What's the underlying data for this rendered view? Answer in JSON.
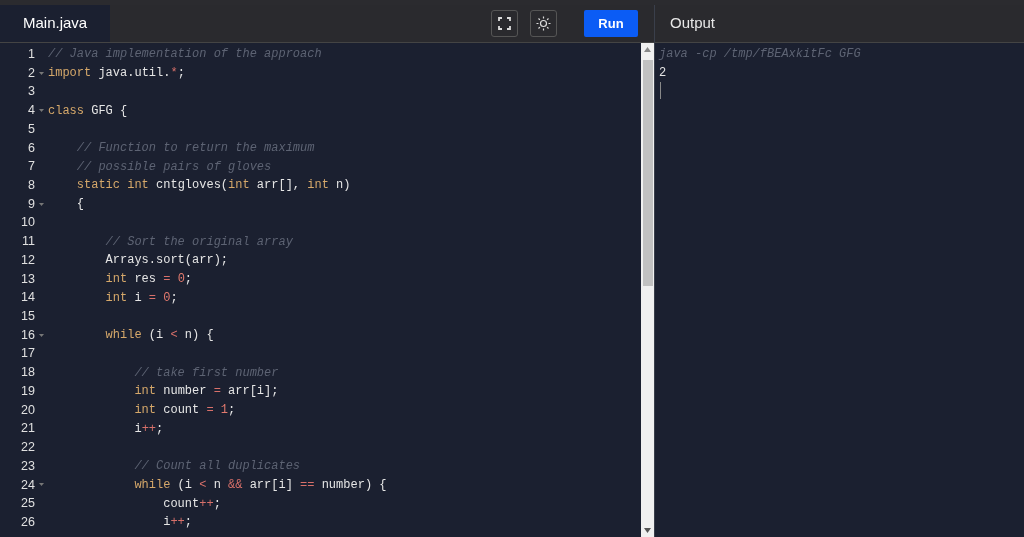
{
  "editor": {
    "tab": {
      "label": "Main.java",
      "selected": true
    },
    "toolbar": [
      {
        "kind": "fullscreen"
      },
      {
        "kind": "theme"
      },
      {
        "kind": "run",
        "label": "Run"
      }
    ],
    "lines": [
      {
        "number": "1",
        "foldable": false,
        "tokens": [
          {
            "kind": "comment",
            "text": "// Java implementation of the approach"
          }
        ]
      },
      {
        "number": "2",
        "foldable": true,
        "tokens": [
          {
            "kind": "keyword",
            "text": "import"
          },
          {
            "kind": "plain",
            "text": " java.util."
          },
          {
            "kind": "operator",
            "text": "*"
          },
          {
            "kind": "plain",
            "text": ";"
          }
        ]
      },
      {
        "number": "3",
        "foldable": false
      },
      {
        "number": "4",
        "foldable": true,
        "tokens": [
          {
            "kind": "keyword",
            "text": "class"
          },
          {
            "kind": "plain",
            "text": " GFG {"
          }
        ]
      },
      {
        "number": "5",
        "foldable": false
      },
      {
        "number": "6",
        "foldable": false,
        "tokens": [
          {
            "kind": "comment",
            "text": "    // Function to return the maximum"
          }
        ]
      },
      {
        "number": "7",
        "foldable": false,
        "tokens": [
          {
            "kind": "comment",
            "text": "    // possible pairs of gloves"
          }
        ]
      },
      {
        "number": "8",
        "foldable": false,
        "tokens": [
          {
            "kind": "keyword",
            "text": "    static int"
          },
          {
            "kind": "plain",
            "text": " cntgloves("
          },
          {
            "kind": "keyword",
            "text": "int"
          },
          {
            "kind": "plain",
            "text": " arr[], "
          },
          {
            "kind": "keyword",
            "text": "int"
          },
          {
            "kind": "plain",
            "text": " n)"
          }
        ]
      },
      {
        "number": "9",
        "foldable": true,
        "tokens": [
          {
            "kind": "plain",
            "text": "    {"
          }
        ]
      },
      {
        "number": "10",
        "foldable": false
      },
      {
        "number": "11",
        "foldable": false,
        "tokens": [
          {
            "kind": "comment",
            "text": "        // Sort the original array"
          }
        ]
      },
      {
        "number": "12",
        "foldable": false,
        "tokens": [
          {
            "kind": "plain",
            "text": "        Arrays.sort(arr);"
          }
        ]
      },
      {
        "number": "13",
        "foldable": false,
        "tokens": [
          {
            "kind": "keyword",
            "text": "        int"
          },
          {
            "kind": "plain",
            "text": " res "
          },
          {
            "kind": "operator",
            "text": "="
          },
          {
            "kind": "number",
            "text": " 0"
          },
          {
            "kind": "plain",
            "text": ";"
          }
        ]
      },
      {
        "number": "14",
        "foldable": false,
        "tokens": [
          {
            "kind": "keyword",
            "text": "        int"
          },
          {
            "kind": "plain",
            "text": " i "
          },
          {
            "kind": "operator",
            "text": "="
          },
          {
            "kind": "number",
            "text": " 0"
          },
          {
            "kind": "plain",
            "text": ";"
          }
        ]
      },
      {
        "number": "15",
        "foldable": false
      },
      {
        "number": "16",
        "foldable": true,
        "tokens": [
          {
            "kind": "keyword",
            "text": "        while"
          },
          {
            "kind": "plain",
            "text": " (i "
          },
          {
            "kind": "operator",
            "text": "<"
          },
          {
            "kind": "plain",
            "text": " n) {"
          }
        ]
      },
      {
        "number": "17",
        "foldable": false
      },
      {
        "number": "18",
        "foldable": false,
        "tokens": [
          {
            "kind": "comment",
            "text": "            // take first number"
          }
        ]
      },
      {
        "number": "19",
        "foldable": false,
        "tokens": [
          {
            "kind": "keyword",
            "text": "            int"
          },
          {
            "kind": "plain",
            "text": " number "
          },
          {
            "kind": "operator",
            "text": "="
          },
          {
            "kind": "plain",
            "text": " arr[i];"
          }
        ]
      },
      {
        "number": "20",
        "foldable": false,
        "tokens": [
          {
            "kind": "keyword",
            "text": "            int"
          },
          {
            "kind": "plain",
            "text": " count "
          },
          {
            "kind": "operator",
            "text": "="
          },
          {
            "kind": "number",
            "text": " 1"
          },
          {
            "kind": "plain",
            "text": ";"
          }
        ]
      },
      {
        "number": "21",
        "foldable": false,
        "tokens": [
          {
            "kind": "plain",
            "text": "            i"
          },
          {
            "kind": "operator",
            "text": "++"
          },
          {
            "kind": "plain",
            "text": ";"
          }
        ]
      },
      {
        "number": "22",
        "foldable": false
      },
      {
        "number": "23",
        "foldable": false,
        "tokens": [
          {
            "kind": "comment",
            "text": "            // Count all duplicates"
          }
        ]
      },
      {
        "number": "24",
        "foldable": true,
        "tokens": [
          {
            "kind": "keyword",
            "text": "            while"
          },
          {
            "kind": "plain",
            "text": " (i "
          },
          {
            "kind": "operator",
            "text": "<"
          },
          {
            "kind": "plain",
            "text": " n "
          },
          {
            "kind": "operator",
            "text": "&&"
          },
          {
            "kind": "plain",
            "text": " arr[i] "
          },
          {
            "kind": "operator",
            "text": "=="
          },
          {
            "kind": "plain",
            "text": " number) {"
          }
        ]
      },
      {
        "number": "25",
        "foldable": false,
        "tokens": [
          {
            "kind": "plain",
            "text": "                count"
          },
          {
            "kind": "operator",
            "text": "++"
          },
          {
            "kind": "plain",
            "text": ";"
          }
        ]
      },
      {
        "number": "26",
        "foldable": false,
        "tokens": [
          {
            "kind": "plain",
            "text": "                i"
          },
          {
            "kind": "operator",
            "text": "++"
          },
          {
            "kind": "plain",
            "text": ";"
          }
        ]
      }
    ]
  },
  "output": {
    "title": "Output",
    "command": "java -cp /tmp/fBEAxkitFc GFG",
    "lines": [
      "2"
    ]
  }
}
